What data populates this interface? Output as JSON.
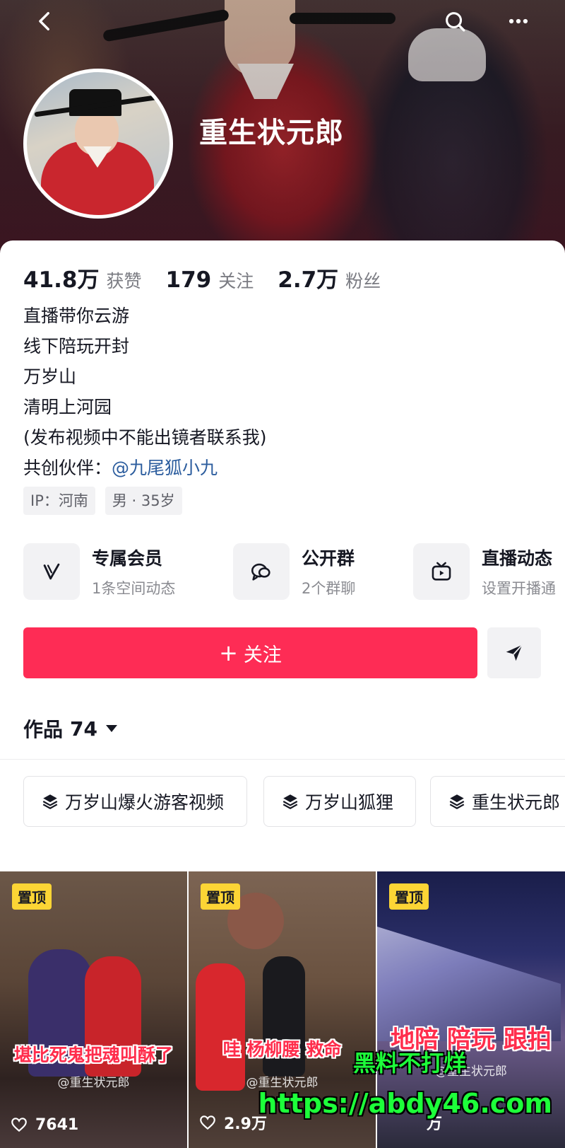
{
  "profile": {
    "nickname": "重生状元郎"
  },
  "stats": [
    {
      "value": "41.8万",
      "label": "获赞"
    },
    {
      "value": "179",
      "label": "关注"
    },
    {
      "value": "2.7万",
      "label": "粉丝"
    }
  ],
  "bio": {
    "lines": [
      "直播带你云游",
      "线下陪玩开封",
      "万岁山",
      "清明上河园",
      "(发布视频中不能出镜者联系我)"
    ],
    "partner_prefix": "共创伙伴：",
    "partner_link": "@九尾狐小九"
  },
  "tags": [
    "IP：河南",
    "男 · 35岁"
  ],
  "features": [
    {
      "title": "专属会员",
      "subtitle": "1条空间动态",
      "icon": "v-icon"
    },
    {
      "title": "公开群",
      "subtitle": "2个群聊",
      "icon": "chat-icon"
    },
    {
      "title": "直播动态",
      "subtitle": "设置开播通",
      "icon": "tv-icon"
    }
  ],
  "actions": {
    "follow_plus": "+",
    "follow_label": "关注",
    "share_icon": "send-icon"
  },
  "works": {
    "label": "作品",
    "count": "74"
  },
  "collections": [
    "万岁山爆火游客视频",
    "万岁山狐狸",
    "重生状元郎"
  ],
  "videos": [
    {
      "pinned": "置顶",
      "caption": "堪比死鬼把魂叫酥了",
      "credit": "@重生状元郎",
      "likes": "7641"
    },
    {
      "pinned": "置顶",
      "caption": "哇 杨柳腰 救命",
      "credit": "@重生状元郎",
      "likes": "2.9万"
    },
    {
      "pinned": "置顶",
      "caption": "地陪 陪玩 跟拍",
      "credit": "@重生状元郎",
      "likes": "万"
    }
  ],
  "watermark": {
    "line1": "黑料不打烊",
    "line2": "https://abdy46.com"
  },
  "colors": {
    "follow_button": "#fe2c55",
    "link": "#2c5d9e",
    "pin_badge": "#fcd535",
    "watermark": "#1dff3a"
  }
}
